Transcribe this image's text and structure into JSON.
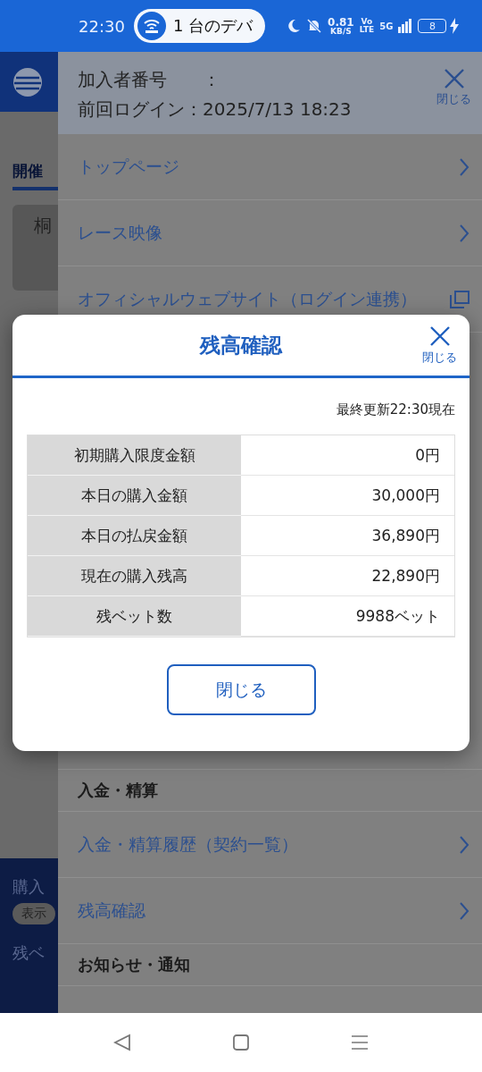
{
  "status_bar": {
    "time": "22:30",
    "notification": "1 台のデバ",
    "net_speed": "0.81",
    "net_unit": "KB/S",
    "volte_top": "Vo",
    "volte_bottom": "LTE",
    "network": "5G",
    "battery": "8"
  },
  "background_page": {
    "tab": "開催",
    "card_text": "桐",
    "balance_label": "購入",
    "show_button": "表示",
    "bets_label": "残ベ"
  },
  "drawer": {
    "member_label": "加入者番号",
    "member_colon": "：",
    "last_login": "前回ログイン：2025/7/13 18:23",
    "close_label": "閉じる",
    "top_items": [
      {
        "kind": "link",
        "label": "トップページ"
      },
      {
        "kind": "link",
        "label": "レース映像"
      },
      {
        "kind": "external",
        "label": "オフィシャルウェブサイト（ログイン連携）"
      }
    ],
    "bottom_items": [
      {
        "kind": "section",
        "label": "入金・精算"
      },
      {
        "kind": "link",
        "label": "入金・精算履歴（契約一覧）"
      },
      {
        "kind": "link",
        "label": "残高確認"
      },
      {
        "kind": "section",
        "label": "お知らせ・通知"
      }
    ]
  },
  "dialog": {
    "title": "残高確認",
    "close_label": "閉じる",
    "updated": "最終更新22:30現在",
    "rows": [
      {
        "label": "初期購入限度金額",
        "value": "0円"
      },
      {
        "label": "本日の購入金額",
        "value": "30,000円"
      },
      {
        "label": "本日の払戻金額",
        "value": "36,890円"
      },
      {
        "label": "現在の購入残高",
        "value": "22,890円"
      },
      {
        "label": "残ベット数",
        "value": "9988ベット"
      }
    ],
    "button": "閉じる"
  }
}
